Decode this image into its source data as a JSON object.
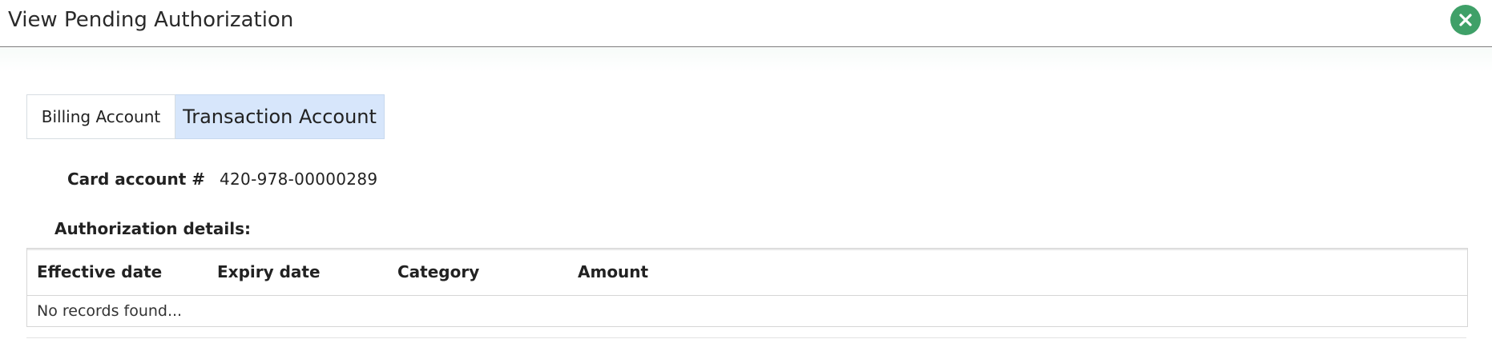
{
  "window": {
    "title": "View Pending Authorization",
    "close_icon": "close-icon"
  },
  "tabs": [
    {
      "label": "Billing Account",
      "active": false
    },
    {
      "label": "Transaction Account",
      "active": true
    }
  ],
  "card": {
    "label": "Card account #",
    "value": "420-978-00000289"
  },
  "authorization": {
    "label": "Authorization details:",
    "columns": [
      "Effective date",
      "Expiry date",
      "Category",
      "Amount"
    ],
    "empty_message": "No records found..."
  },
  "colors": {
    "close_button": "#3fa068",
    "active_tab": "#d7e6fb"
  }
}
